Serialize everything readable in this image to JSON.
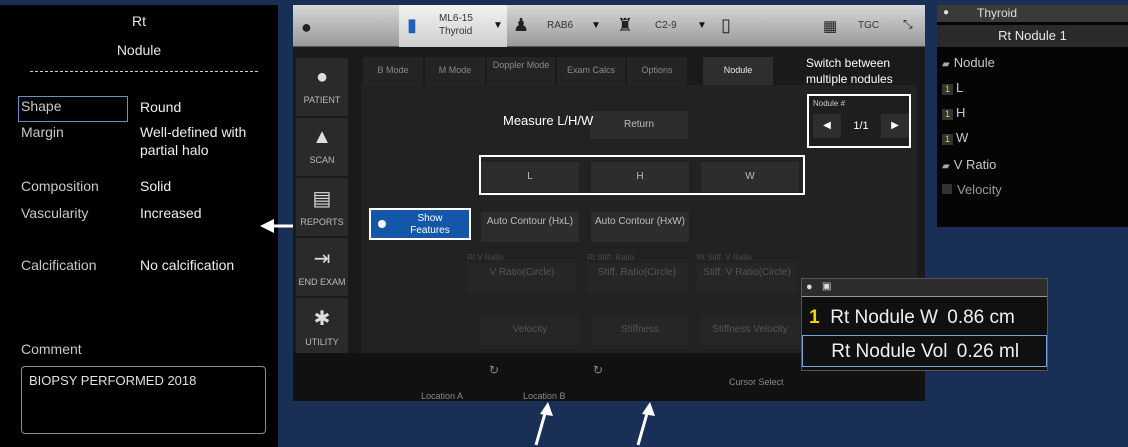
{
  "left_panel": {
    "side": "Rt",
    "title": "Nodule",
    "features": [
      {
        "label": "Shape",
        "value": "Round"
      },
      {
        "label": "Margin",
        "value": "Well-defined with partial halo"
      },
      {
        "label": "Composition",
        "value": "Solid"
      },
      {
        "label": "Vascularity",
        "value": "Increased"
      },
      {
        "label": "Calcification",
        "value": "No calcification"
      }
    ],
    "comment_label": "Comment",
    "comment_text": "BIOPSY PERFORMED 2018"
  },
  "topbar": {
    "probe1_name": "ML6-15",
    "probe1_preset": "Thyroid",
    "probe2_name": "RAB6",
    "probe3_name": "C2-9",
    "tgc_label": "TGC"
  },
  "sidebar": [
    {
      "label": "PATIENT",
      "icon": "person-icon"
    },
    {
      "label": "SCAN",
      "icon": "scan-icon"
    },
    {
      "label": "REPORTS",
      "icon": "report-icon"
    },
    {
      "label": "END EXAM",
      "icon": "exit-icon"
    },
    {
      "label": "UTILITY",
      "icon": "gear-icon"
    }
  ],
  "tabs": [
    "B Mode",
    "M Mode",
    "Doppler Mode",
    "Exam Calcs",
    "Options",
    "Nodule"
  ],
  "active_tab": "Nodule",
  "content": {
    "return": "Return",
    "l": "L",
    "h": "H",
    "w": "W",
    "show_features": "Show Features",
    "auto_contour_hxl": "Auto Contour (HxL)",
    "auto_contour_hxw": "Auto Contour (HxW)",
    "rt_v_ratio_lbl": "Rt V Ratio",
    "v_ratio_circle": "V Ratio(Circle)",
    "rt_stiff_ratio_lbl": "Rt Stiff. Ratio",
    "stiff_ratio_circle": "Stiff. Ratio(Circle)",
    "rt_stiffv_ratio_lbl": "Rt Stiff. V Ratio",
    "stiffv_ratio_circle": "Stiff. V Ratio(Circle)",
    "velocity": "Velocity",
    "stiffness": "Stiffness",
    "stiffness_velocity": "Stiffness Velocity",
    "nodule_num_lbl": "Nodule #",
    "nodule_page": "1/1"
  },
  "bottombar": {
    "location_a": "Location A",
    "location_b": "Location B",
    "cursor_select": "Cursor Select"
  },
  "annotations": {
    "switch_nodules": "Switch between multiple nodules",
    "measure": "Measure L/H/W"
  },
  "right_panel": {
    "header": "Thyroid",
    "subheader": "Rt Nodule 1",
    "items": [
      {
        "label": "Nodule",
        "marker": "folder"
      },
      {
        "label": "L",
        "marker": "1"
      },
      {
        "label": "H",
        "marker": "1"
      },
      {
        "label": "W",
        "marker": "1"
      },
      {
        "label": "V Ratio",
        "marker": "folder"
      },
      {
        "label": "Velocity",
        "marker": "box"
      }
    ]
  },
  "measurements": [
    {
      "index": "1",
      "label": "Rt Nodule W",
      "value": "0.86 cm"
    },
    {
      "index": "",
      "label": "Rt Nodule Vol",
      "value": "0.26 ml"
    }
  ]
}
